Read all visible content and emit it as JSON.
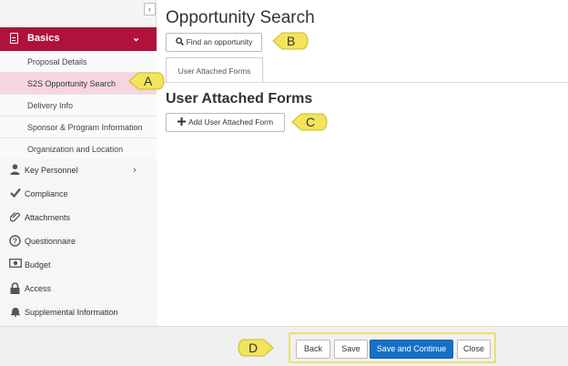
{
  "sidebar": {
    "collapse_glyph": "‹",
    "section": {
      "label": "Basics",
      "icon": "document-icon"
    },
    "subitems": [
      "Proposal Details",
      "S2S Opportunity Search",
      "Delivery Info",
      "Sponsor & Program Information",
      "Organization and Location"
    ],
    "active_subitem": "S2S Opportunity Search",
    "items": [
      {
        "label": "Key Personnel",
        "icon": "person-icon"
      },
      {
        "label": "Compliance",
        "icon": "checkmark-icon"
      },
      {
        "label": "Attachments",
        "icon": "paperclip-icon"
      },
      {
        "label": "Questionnaire",
        "icon": "question-circle-icon"
      },
      {
        "label": "Budget",
        "icon": "money-icon"
      },
      {
        "label": "Access",
        "icon": "lock-icon"
      },
      {
        "label": "Supplemental Information",
        "icon": "bell-icon"
      }
    ]
  },
  "main": {
    "title": "Opportunity Search",
    "find_button": "Find an opportunity",
    "tab": "User Attached Forms",
    "section_title": "User Attached Forms",
    "add_button": "Add User Attached Form"
  },
  "footer": {
    "back": "Back",
    "save": "Save",
    "save_continue": "Save and Continue",
    "close": "Close"
  },
  "callouts": [
    "A",
    "B",
    "C",
    "D"
  ],
  "colors": {
    "accent": "#b0123b",
    "active_bg": "#f6d6de",
    "primary_button": "#1570c8",
    "callout": "#f3e45c"
  }
}
